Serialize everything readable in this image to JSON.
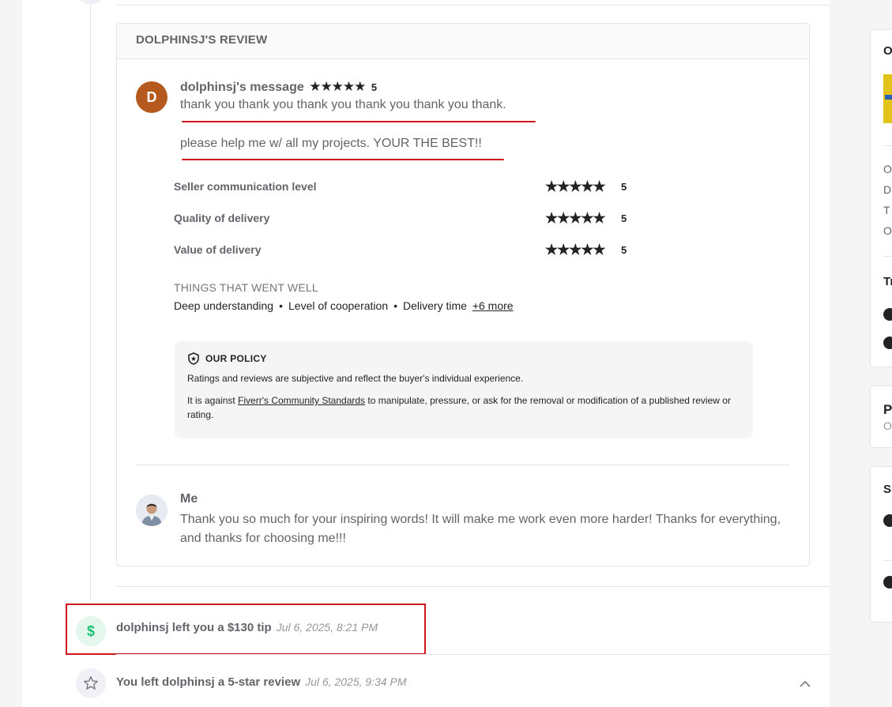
{
  "review": {
    "header": "DOLPHINSJ'S REVIEW",
    "avatar_initial": "D",
    "message_title": "dolphinsj's message",
    "overall_stars": "★★★★★",
    "overall_rating": "5",
    "message_line1": "thank you thank you thank you thank you thank you thank.",
    "message_line2": "please help me w/ all my projects. YOUR THE BEST!!",
    "ratings": [
      {
        "label": "Seller communication level",
        "stars": "★★★★★",
        "value": "5"
      },
      {
        "label": "Quality of delivery",
        "stars": "★★★★★",
        "value": "5"
      },
      {
        "label": "Value of delivery",
        "stars": "★★★★★",
        "value": "5"
      }
    ],
    "things_title": "THINGS THAT WENT WELL",
    "things": [
      "Deep understanding",
      "Level of cooperation",
      "Delivery time"
    ],
    "things_bullet": "•",
    "things_more": "+6 more",
    "policy": {
      "title": "OUR POLICY",
      "p1": "Ratings and reviews are subjective and reflect the buyer's individual experience.",
      "p2_before": "It is against ",
      "p2_link": "Fiverr's Community Standards",
      "p2_after": " to manipulate, pressure, or ask for the removal or modification of a published review or rating."
    },
    "reply_name": "Me",
    "reply_text": "Thank you so much for your inspiring words! It will make me work even more harder! Thanks for everything, and thanks for choosing me!!!"
  },
  "events": [
    {
      "text": "dolphinsj left you a $130 tip",
      "time": "Jul 6, 2025, 8:21 PM",
      "icon": "dollar-icon",
      "icon_glyph": "$",
      "color": "#1dbf73"
    },
    {
      "text": "You left dolphinsj a 5-star review",
      "time": "Jul 6, 2025, 9:34 PM",
      "icon": "star-outline-icon",
      "color": "#74767e"
    }
  ],
  "colors": {
    "highlight": "#d0161c",
    "avatar": "#b5591f",
    "accent": "#1dbf73"
  },
  "sidebar": {
    "card1_chars": [
      "O",
      "O",
      "D",
      "T",
      "O"
    ],
    "card1_heading": "Tr",
    "card2_heading": "P",
    "card2_sub": "O",
    "card3_heading": "Su"
  }
}
